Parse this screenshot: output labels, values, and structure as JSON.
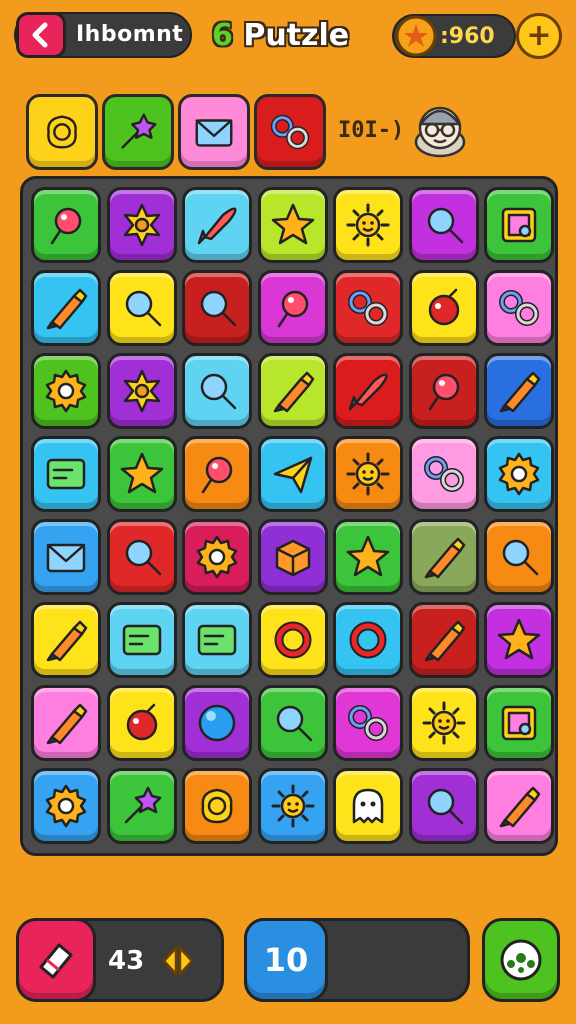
{
  "header": {
    "back_title": "Ihbomnt",
    "title_number": "6",
    "title_text": "Putzle",
    "coins": ":960",
    "add_label": "+"
  },
  "targets": {
    "moves_text": "I0I-)",
    "tiles": [
      {
        "color": "#ffd21a",
        "icon": "coin-blob-icon"
      },
      {
        "color": "#4ec21e",
        "icon": "wand-icon"
      },
      {
        "color": "#ff8ad8",
        "icon": "envelope-icon"
      },
      {
        "color": "#d91c1c",
        "icon": "rings-icon"
      }
    ]
  },
  "board": {
    "rows": [
      [
        {
          "color": "#3cc43a",
          "icon": "pin-icon"
        },
        {
          "color": "#a12fd6",
          "icon": "star-badge-icon"
        },
        {
          "color": "#5fd3f2",
          "icon": "rocket-icon"
        },
        {
          "color": "#b8e62a",
          "icon": "star-icon"
        },
        {
          "color": "#ffe31a",
          "icon": "sun-icon"
        },
        {
          "color": "#c230e0",
          "icon": "magnifier-icon"
        },
        {
          "color": "#3cc43a",
          "icon": "frame-icon"
        }
      ],
      [
        {
          "color": "#35c3f2",
          "icon": "crayon-icon"
        },
        {
          "color": "#ffe31a",
          "icon": "magnifier-icon"
        },
        {
          "color": "#c81f1f",
          "icon": "magnifier-icon"
        },
        {
          "color": "#d937d6",
          "icon": "pin-icon"
        },
        {
          "color": "#e02828",
          "icon": "rings-icon"
        },
        {
          "color": "#ffe31a",
          "icon": "bomb-icon"
        },
        {
          "color": "#ff7fe0",
          "icon": "rings-icon"
        }
      ],
      [
        {
          "color": "#4ec21e",
          "icon": "gear-icon"
        },
        {
          "color": "#a12fd6",
          "icon": "star-badge-icon"
        },
        {
          "color": "#5fd3f2",
          "icon": "magnifier-icon"
        },
        {
          "color": "#b8e62a",
          "icon": "crayon-icon"
        },
        {
          "color": "#d91c1c",
          "icon": "rocket-icon"
        },
        {
          "color": "#c81f1f",
          "icon": "pin-icon"
        },
        {
          "color": "#2a6fe0",
          "icon": "crayon-icon"
        }
      ],
      [
        {
          "color": "#35c3f2",
          "icon": "card-icon"
        },
        {
          "color": "#3cc43a",
          "icon": "star-icon"
        },
        {
          "color": "#f78a12",
          "icon": "pin-icon"
        },
        {
          "color": "#35c3f2",
          "icon": "plane-icon"
        },
        {
          "color": "#f78a12",
          "icon": "sun-icon"
        },
        {
          "color": "#ff9be2",
          "icon": "rings-icon"
        },
        {
          "color": "#35c3f2",
          "icon": "gear-icon"
        }
      ],
      [
        {
          "color": "#35a3f2",
          "icon": "envelope-icon"
        },
        {
          "color": "#e02828",
          "icon": "magnifier-icon"
        },
        {
          "color": "#d91c5a",
          "icon": "gear-icon"
        },
        {
          "color": "#8f2fd6",
          "icon": "box-icon"
        },
        {
          "color": "#3cc43a",
          "icon": "star-icon"
        },
        {
          "color": "#8aa85a",
          "icon": "crayon-icon"
        },
        {
          "color": "#f78a12",
          "icon": "magnifier-icon"
        }
      ],
      [
        {
          "color": "#ffe31a",
          "icon": "crayon-icon"
        },
        {
          "color": "#5fd3f2",
          "icon": "card-icon"
        },
        {
          "color": "#5fd3f2",
          "icon": "card-icon"
        },
        {
          "color": "#ffe31a",
          "icon": "ring-icon"
        },
        {
          "color": "#35c3f2",
          "icon": "ring-icon"
        },
        {
          "color": "#c81f1f",
          "icon": "crayon-icon"
        },
        {
          "color": "#c230e0",
          "icon": "star-icon"
        }
      ],
      [
        {
          "color": "#ff7fe0",
          "icon": "crayon-icon"
        },
        {
          "color": "#ffe31a",
          "icon": "bomb-icon"
        },
        {
          "color": "#a12fd6",
          "icon": "ball-icon"
        },
        {
          "color": "#3cc43a",
          "icon": "magnifier-icon"
        },
        {
          "color": "#e037d6",
          "icon": "rings-icon"
        },
        {
          "color": "#ffe31a",
          "icon": "sun-icon"
        },
        {
          "color": "#3cc43a",
          "icon": "frame-icon"
        }
      ],
      [
        {
          "color": "#35a3f2",
          "icon": "gear-icon"
        },
        {
          "color": "#3cc43a",
          "icon": "wand-icon"
        },
        {
          "color": "#f78a12",
          "icon": "coin-blob-icon"
        },
        {
          "color": "#35a3f2",
          "icon": "sun-icon"
        },
        {
          "color": "#ffe31a",
          "icon": "ghost-icon"
        },
        {
          "color": "#a12fd6",
          "icon": "magnifier-icon"
        },
        {
          "color": "#ff7fe0",
          "icon": "crayon-icon"
        }
      ]
    ]
  },
  "footer": {
    "booster_count": "43",
    "level": "10"
  }
}
